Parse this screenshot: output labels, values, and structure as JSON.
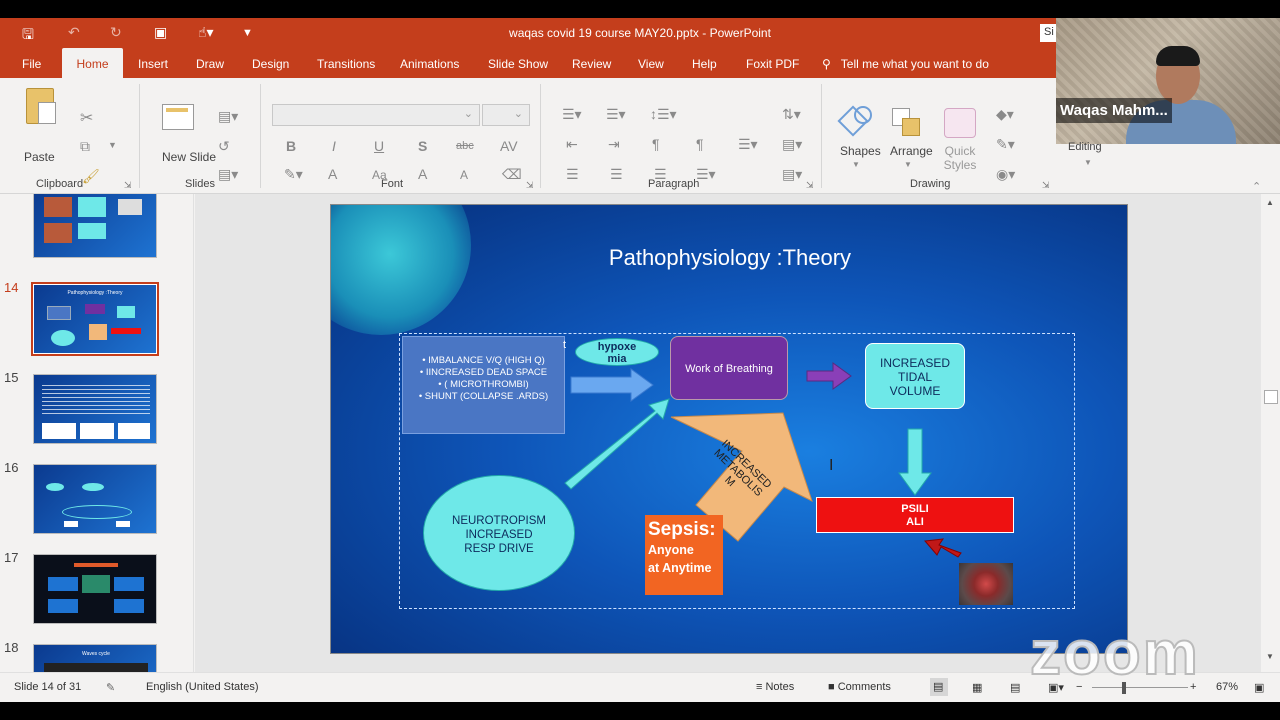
{
  "title_bar": {
    "document_title": "waqas covid 19 course MAY20.pptx  -  PowerPoint",
    "signin_label": "Si"
  },
  "menu": {
    "tabs": [
      "File",
      "Home",
      "Insert",
      "Draw",
      "Design",
      "Transitions",
      "Animations",
      "Slide Show",
      "Review",
      "View",
      "Help",
      "Foxit PDF"
    ],
    "active_tab": "Home",
    "tell_me": "Tell me what you want to do"
  },
  "ribbon": {
    "clipboard": {
      "paste_label": "Paste",
      "group_label": "Clipboard"
    },
    "slides": {
      "new_slide_label": "New Slide",
      "group_label": "Slides"
    },
    "font": {
      "group_label": "Font",
      "bold": "B",
      "italic": "I",
      "underline": "U",
      "shadow": "S",
      "strike": "abc",
      "spacing": "AV",
      "font_color": "A",
      "change_case": "Aa",
      "grow": "A",
      "shrink": "A"
    },
    "paragraph": {
      "group_label": "Paragraph"
    },
    "drawing": {
      "shapes_label": "Shapes",
      "arrange_label": "Arrange",
      "quick_styles_label": "Quick Styles",
      "group_label": "Drawing"
    },
    "editing_label": "Editing"
  },
  "camera": {
    "participant_name": "Waqas Mahm..."
  },
  "thumbnails": [
    {
      "number": "14",
      "selected": true,
      "thumb_title": "Pathophysiology :Theory"
    },
    {
      "number": "15",
      "selected": false
    },
    {
      "number": "16",
      "selected": false
    },
    {
      "number": "17",
      "selected": false
    },
    {
      "number": "18",
      "selected": false,
      "thumb_title": "Waves cycle"
    }
  ],
  "slide": {
    "title": "Pathophysiology :Theory",
    "bullets": [
      "IMBALANCE V/Q (HIGH Q)",
      "IINCREASED DEAD SPACE",
      "( MICROTHROMBI)",
      "SHUNT (COLLAPSE .ARDS)"
    ],
    "stray_char": "t",
    "hypoxemia": [
      "hypoxe",
      "mia"
    ],
    "work_of_breathing": "Work of Breathing",
    "increased_tidal_volume": [
      "INCREASED",
      "TIDAL",
      "VOLUME"
    ],
    "neurotropism": [
      "NEUROTROPISM",
      "INCREASED",
      "RESP DRIVE"
    ],
    "psili": [
      "PSILI",
      "ALI"
    ],
    "increased_metabolism": [
      "INCREASED",
      "METABOLIS",
      "M"
    ],
    "sepsis": {
      "heading": "Sepsis:",
      "line1": "Anyone",
      "line2": "at Anytime"
    }
  },
  "status": {
    "slide_indicator": "Slide 14 of 31",
    "language": "English (United States)",
    "notes_label": "Notes",
    "comments_label": "Comments",
    "zoom_level": "67%"
  },
  "watermark": "zoom",
  "colors": {
    "accent": "#c43e1c",
    "slide_purple": "#7030a0",
    "slide_cyan": "#6ee8e8",
    "slide_red": "#ee1111",
    "sepsis_orange": "#f26522"
  }
}
